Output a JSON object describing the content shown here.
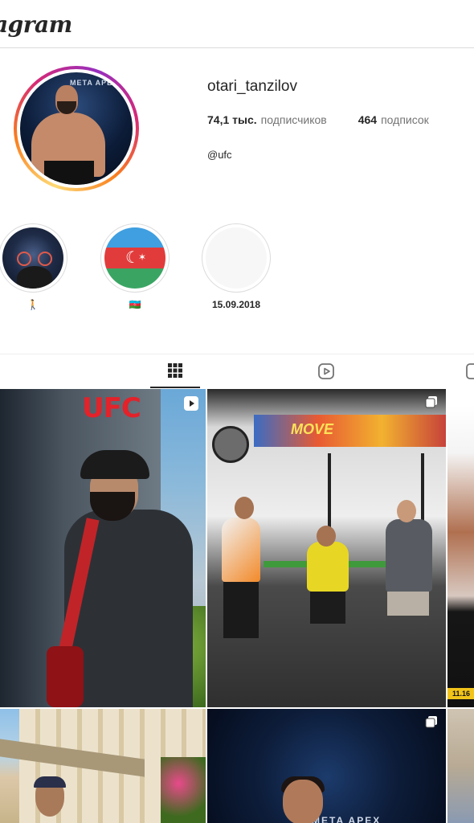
{
  "header": {
    "brand": "Instagram"
  },
  "profile": {
    "username": "otari_tanzilov",
    "followers_count": "74,1 тыс.",
    "followers_label": "подписчиков",
    "following_count": "464",
    "following_label": "подписок",
    "bio_link": "@ufc",
    "avatar_banner": "META APEX"
  },
  "highlights": [
    {
      "label": "🚶"
    },
    {
      "label": "🇦🇿"
    },
    {
      "label": "15.09.2018"
    }
  ],
  "tabs": [
    {
      "icon": "grid-icon",
      "active": true
    },
    {
      "icon": "reels-icon",
      "active": false
    },
    {
      "icon": "tagged-icon",
      "active": false
    }
  ],
  "posts": [
    {
      "type": "reel",
      "text": "UFC"
    },
    {
      "type": "carousel",
      "text": "MOVE"
    },
    {
      "type": "video",
      "text": "11.16"
    },
    {
      "type": "image",
      "text": ""
    },
    {
      "type": "carousel",
      "text": "META APEX"
    },
    {
      "type": "image",
      "text": ""
    }
  ],
  "colors": {
    "ring_start": "#feda75",
    "ring_mid": "#d62976",
    "ring_end": "#962fbf",
    "text_primary": "#262626",
    "text_secondary": "#737373",
    "divider": "#dbdbdb"
  }
}
